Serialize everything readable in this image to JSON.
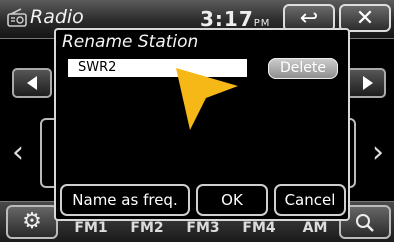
{
  "header": {
    "title": "Radio",
    "clock": "3:17",
    "clock_suffix": "PM",
    "back_icon": "↩",
    "close_icon": "✕"
  },
  "background": {
    "bands": [
      "FM1",
      "FM2",
      "FM3",
      "FM4",
      "AM"
    ]
  },
  "dialog": {
    "title": "Rename Station",
    "station_name": "SWR2",
    "delete_label": "Delete",
    "name_as_freq_label": "Name as freq.",
    "ok_label": "OK",
    "cancel_label": "Cancel"
  },
  "colors": {
    "pointer": "#f5b816",
    "dialog_border": "#d8d8d8",
    "delete_button": "#a8a8a8"
  },
  "icons": {
    "radio": "radio-icon",
    "back": "back-arrow-icon",
    "close": "close-icon",
    "settings": "gear-icon",
    "search": "search-icon",
    "pointer": "pointer-arrow-icon"
  }
}
